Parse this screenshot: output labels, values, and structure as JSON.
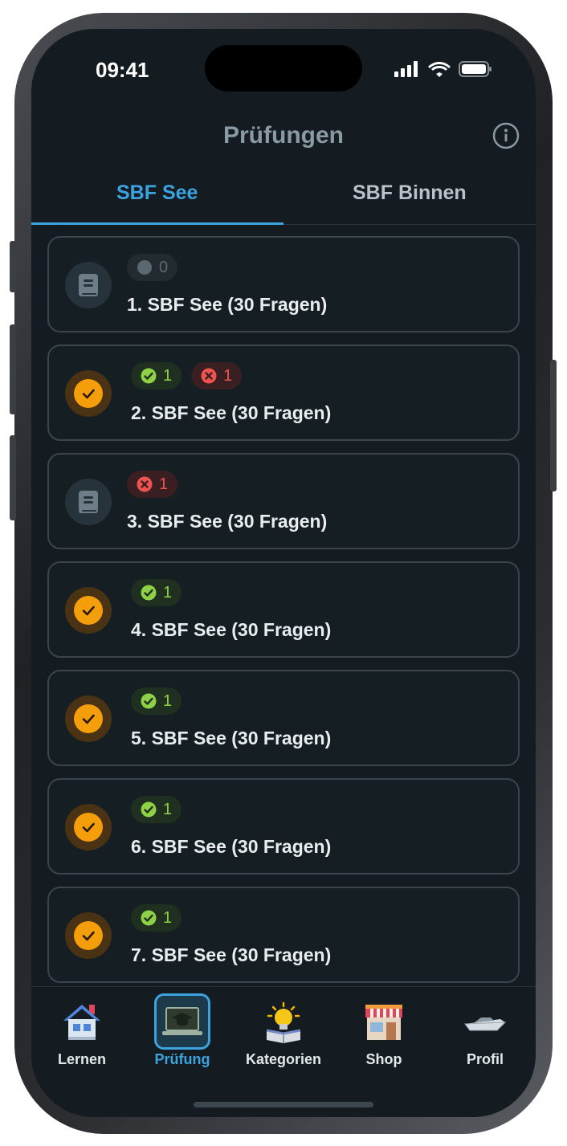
{
  "status_bar": {
    "time": "09:41"
  },
  "header": {
    "title": "Prüfungen"
  },
  "tabs": [
    {
      "label": "SBF See",
      "active": true
    },
    {
      "label": "SBF Binnen",
      "active": false
    }
  ],
  "exams": [
    {
      "title": "1. SBF See (30 Fragen)",
      "state": "book",
      "badges": [
        {
          "type": "grey",
          "count": "0"
        }
      ]
    },
    {
      "title": "2. SBF See (30 Fragen)",
      "state": "done",
      "badges": [
        {
          "type": "green",
          "count": "1"
        },
        {
          "type": "red",
          "count": "1"
        }
      ]
    },
    {
      "title": "3. SBF See (30 Fragen)",
      "state": "book",
      "badges": [
        {
          "type": "red",
          "count": "1"
        }
      ]
    },
    {
      "title": "4. SBF See (30 Fragen)",
      "state": "done",
      "badges": [
        {
          "type": "green",
          "count": "1"
        }
      ]
    },
    {
      "title": "5. SBF See (30 Fragen)",
      "state": "done",
      "badges": [
        {
          "type": "green",
          "count": "1"
        }
      ]
    },
    {
      "title": "6. SBF See (30 Fragen)",
      "state": "done",
      "badges": [
        {
          "type": "green",
          "count": "1"
        }
      ]
    },
    {
      "title": "7. SBF See (30 Fragen)",
      "state": "done",
      "badges": [
        {
          "type": "green",
          "count": "1"
        }
      ]
    }
  ],
  "nav": [
    {
      "label": "Lernen",
      "icon": "house-icon",
      "active": false
    },
    {
      "label": "Prüfung",
      "icon": "laptop-graduation-icon",
      "active": true
    },
    {
      "label": "Kategorien",
      "icon": "lightbulb-book-icon",
      "active": false
    },
    {
      "label": "Shop",
      "icon": "storefront-icon",
      "active": false
    },
    {
      "label": "Profil",
      "icon": "boat-icon",
      "active": false
    }
  ],
  "colors": {
    "accent": "#3ba3e0",
    "background": "#141c21",
    "success": "#8ed147",
    "error": "#ef5350",
    "completed": "#f59e0b"
  }
}
